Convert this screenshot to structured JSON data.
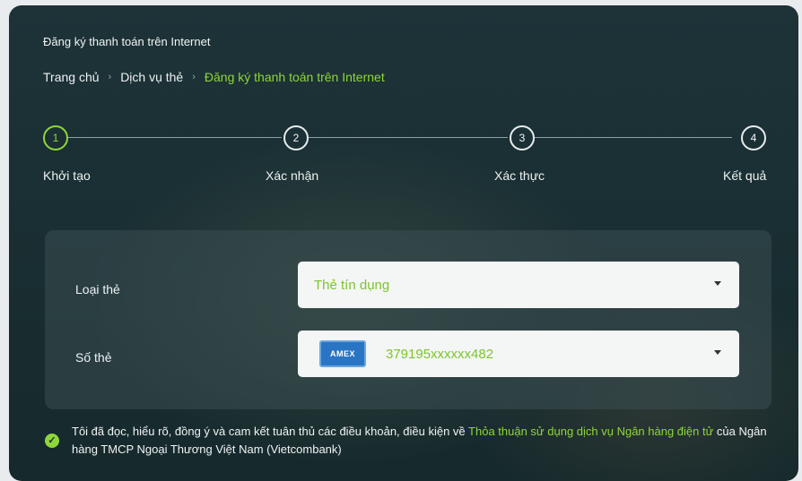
{
  "page": {
    "title": "Đăng ký thanh toán trên Internet"
  },
  "breadcrumb": {
    "items": [
      "Trang chủ",
      "Dịch vụ thẻ",
      "Đăng ký thanh toán trên Internet"
    ],
    "separator": "›"
  },
  "stepper": {
    "steps": [
      {
        "number": "1",
        "label": "Khởi tạo",
        "active": true
      },
      {
        "number": "2",
        "label": "Xác nhận",
        "active": false
      },
      {
        "number": "3",
        "label": "Xác thực",
        "active": false
      },
      {
        "number": "4",
        "label": "Kết quả",
        "active": false
      }
    ]
  },
  "form": {
    "card_type": {
      "label": "Loại thẻ",
      "value": "Thẻ tín dụng",
      "icon": "chevron-down-icon"
    },
    "card_number": {
      "label": "Số thẻ",
      "value": "379195xxxxxx482",
      "brand": "AMEX",
      "icon": "chevron-down-icon"
    }
  },
  "agreement": {
    "text_before": "Tôi đã đọc, hiểu rõ, đồng ý và cam kết tuân thủ các điều khoản, điều kiện về ",
    "link_text": "Thỏa thuận sử dụng dịch vụ Ngân hàng điện tử",
    "text_after": " của Ngân hàng TMCP Ngoại Thương Việt Nam (Vietcombank)",
    "checked": true
  },
  "colors": {
    "accent": "#8fd63a",
    "background": "#1a2f33",
    "field_bg": "#f4f5f5"
  }
}
